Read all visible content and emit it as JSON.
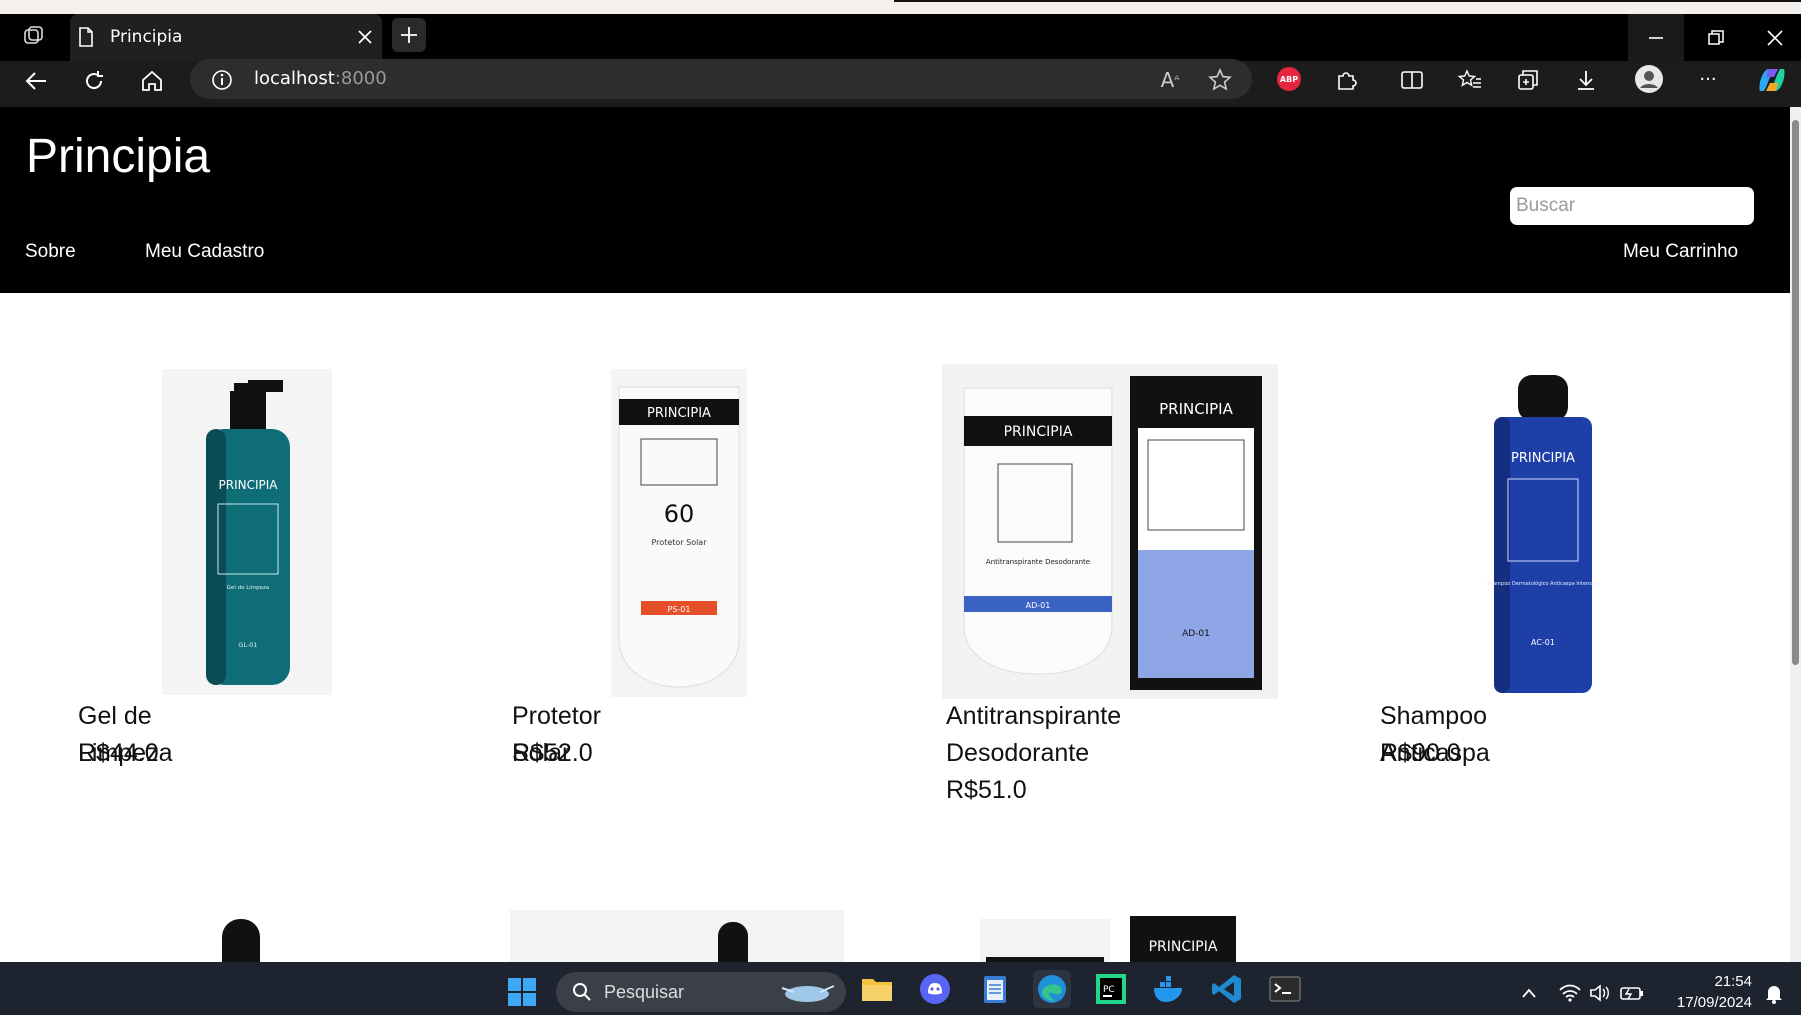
{
  "browser": {
    "tab_title": "Principia",
    "url_host": "localhost",
    "url_port": ":8000",
    "read_aloud_label": "A",
    "abp_label": "ABP",
    "more_label": "···"
  },
  "site": {
    "title": "Principia",
    "search_placeholder": "Buscar",
    "nav": {
      "about": "Sobre",
      "register": "Meu Cadastro",
      "cart": "Meu Carrinho"
    }
  },
  "products": [
    {
      "name": "Gel de Limpeza",
      "price": "R$44.0",
      "brand": "PRINCIPIA",
      "code": "GL-01",
      "subtitle": "Gel de Limpeza"
    },
    {
      "name": "Protetor Solar",
      "price": "R$52.0",
      "brand": "PRINCIPIA",
      "code": "PS-01",
      "subtitle": "Protetor Solar",
      "spf": "60"
    },
    {
      "name_line1": "Antitranspirante",
      "name_line2": "Desodorante",
      "price": "R$51.0",
      "brand": "PRINCIPIA",
      "code": "AD-01",
      "subtitle": "Antitranspirante Desodorante"
    },
    {
      "name": "Shampoo Anticaspa",
      "price": "R$90.0",
      "brand": "PRINCIPIA",
      "code": "AC-01",
      "subtitle": "Shampoo Dermatológico Anticaspa Intensivo"
    }
  ],
  "second_row": {
    "brand": "PRINCIPIA"
  },
  "taskbar": {
    "search_label": "Pesquisar",
    "time": "21:54",
    "date": "17/09/2024"
  },
  "colors": {
    "header_bg": "#000000",
    "page_bg": "#ffffff",
    "taskbar_bg": "#1d2430"
  }
}
